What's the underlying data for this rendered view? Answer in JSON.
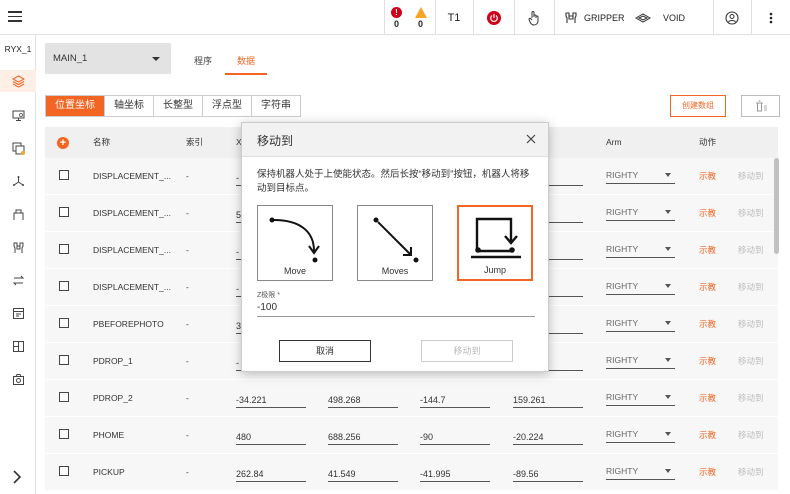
{
  "topbar": {
    "error_count": "0",
    "warning_count": "0",
    "mode": "T1",
    "gripper_label": "GRIPPER",
    "void_label": "VOID"
  },
  "sidebar": {
    "robot_name": "RYX_1",
    "items": [
      "layers-icon",
      "screen-icon",
      "program-icon",
      "axes-icon",
      "tool-icon",
      "gripper-icon",
      "transfer-icon",
      "log-icon",
      "layout-icon",
      "camera-icon"
    ]
  },
  "program": {
    "selected": "MAIN_1",
    "tabs": [
      "程序",
      "数据"
    ],
    "active_tab": "数据"
  },
  "type_tabs": [
    "位置坐标",
    "轴坐标",
    "长整型",
    "浮点型",
    "字符串"
  ],
  "actions": {
    "create_label": "创建数组"
  },
  "table": {
    "headers": {
      "name": "名称",
      "index": "索引",
      "x": "X",
      "arm": "Arm",
      "action": "动作"
    },
    "rows": [
      {
        "name": "DISPLACEMENT_...",
        "index": "-",
        "x": "-",
        "y": "",
        "z": "",
        "r": "",
        "arm": "RIGHTY",
        "teach": "示教",
        "moveto": "移动到"
      },
      {
        "name": "DISPLACEMENT_...",
        "index": "-",
        "x": "5",
        "y": "",
        "z": "",
        "r": "",
        "arm": "RIGHTY",
        "teach": "示教",
        "moveto": "移动到"
      },
      {
        "name": "DISPLACEMENT_...",
        "index": "-",
        "x": "-",
        "y": "",
        "z": "",
        "r": "5",
        "arm": "RIGHTY",
        "teach": "示教",
        "moveto": "移动到"
      },
      {
        "name": "DISPLACEMENT_...",
        "index": "-",
        "x": "-",
        "y": "",
        "z": "",
        "r": "",
        "arm": "RIGHTY",
        "teach": "示教",
        "moveto": "移动到"
      },
      {
        "name": "PBEFOREPHOTO",
        "index": "-",
        "x": "3",
        "y": "",
        "z": "",
        "r": "",
        "arm": "RIGHTY",
        "teach": "示教",
        "moveto": "移动到"
      },
      {
        "name": "PDROP_1",
        "index": "-",
        "x": "-",
        "y": "",
        "z": "",
        "r": "",
        "arm": "RIGHTY",
        "teach": "示教",
        "moveto": "移动到"
      },
      {
        "name": "PDROP_2",
        "index": "-",
        "x": "-34.221",
        "y": "498.268",
        "z": "-144.7",
        "r": "159.261",
        "arm": "RIGHTY",
        "teach": "示教",
        "moveto": "移动到"
      },
      {
        "name": "PHOME",
        "index": "-",
        "x": "480",
        "y": "688.256",
        "z": "-90",
        "r": "-20.224",
        "arm": "RIGHTY",
        "teach": "示教",
        "moveto": "移动到"
      },
      {
        "name": "PICKUP",
        "index": "-",
        "x": "262.84",
        "y": "41.549",
        "z": "-41.995",
        "r": "-89.56",
        "arm": "RIGHTY",
        "teach": "示教",
        "moveto": "移动到"
      }
    ]
  },
  "dialog": {
    "title": "移动到",
    "message": "保持机器人处于上使能状态。然后长按“移动到”按钮，机器人将移动到目标点。",
    "modes": [
      "Move",
      "Moves",
      "Jump"
    ],
    "selected_mode": "Jump",
    "z_label": "Z极限 *",
    "z_value": "-100",
    "cancel_label": "取消",
    "moveto_label": "移动到"
  },
  "colors": {
    "accent": "#f26522",
    "error": "#d0021b",
    "warning": "#f5a623"
  }
}
